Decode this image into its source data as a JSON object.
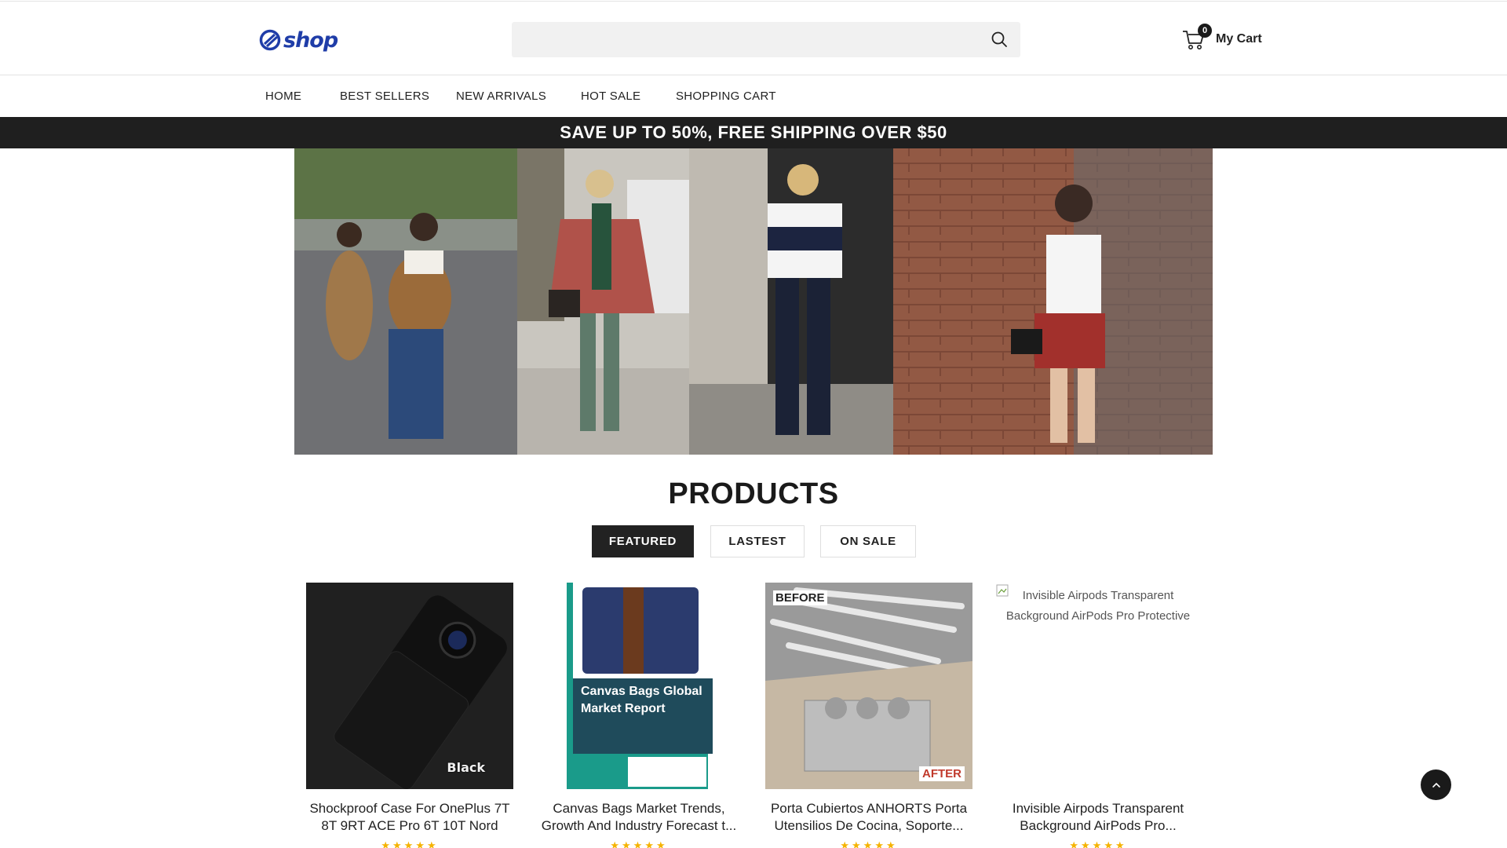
{
  "header": {
    "logo_text": "shop",
    "search": {
      "placeholder": "",
      "value": ""
    },
    "cart": {
      "count": "0",
      "label": "My Cart"
    }
  },
  "nav": {
    "items": [
      {
        "label": "HOME"
      },
      {
        "label": "BEST SELLERS"
      },
      {
        "label": "NEW ARRIVALS"
      },
      {
        "label": "HOT SALE"
      },
      {
        "label": "SHOPPING CART"
      }
    ]
  },
  "banner": {
    "text": "SAVE UP TO 50%, FREE SHIPPING OVER $50"
  },
  "products": {
    "title": "PRODUCTS",
    "tabs": [
      {
        "label": "FEATURED",
        "active": true
      },
      {
        "label": "LASTEST",
        "active": false
      },
      {
        "label": "ON SALE",
        "active": false
      }
    ],
    "items": [
      {
        "title": "Shockproof Case For OnePlus 7T 8T 9RT ACE Pro 6T 10T Nord",
        "image_label": "Black",
        "rating": "★★★★★"
      },
      {
        "title": "Canvas Bags Market Trends, Growth And Industry Forecast t...",
        "image_label": "Canvas Bags Global Market Report",
        "rating": "★★★★★"
      },
      {
        "title": "Porta Cubiertos ANHORTS Porta Utensilios De Cocina, Soporte...",
        "image_label_top": "BEFORE",
        "image_label_bottom": "AFTER",
        "rating": "★★★★★"
      },
      {
        "title": "Invisible Airpods Transparent Background AirPods Pro...",
        "image_alt": "Invisible Airpods Transparent Background AirPods Pro Protective",
        "rating": "★★★★★"
      }
    ]
  },
  "colors": {
    "brand": "#1f3da8",
    "banner_bg": "#1f1f1f",
    "star": "#f5b301",
    "active_tab": "#222222"
  }
}
